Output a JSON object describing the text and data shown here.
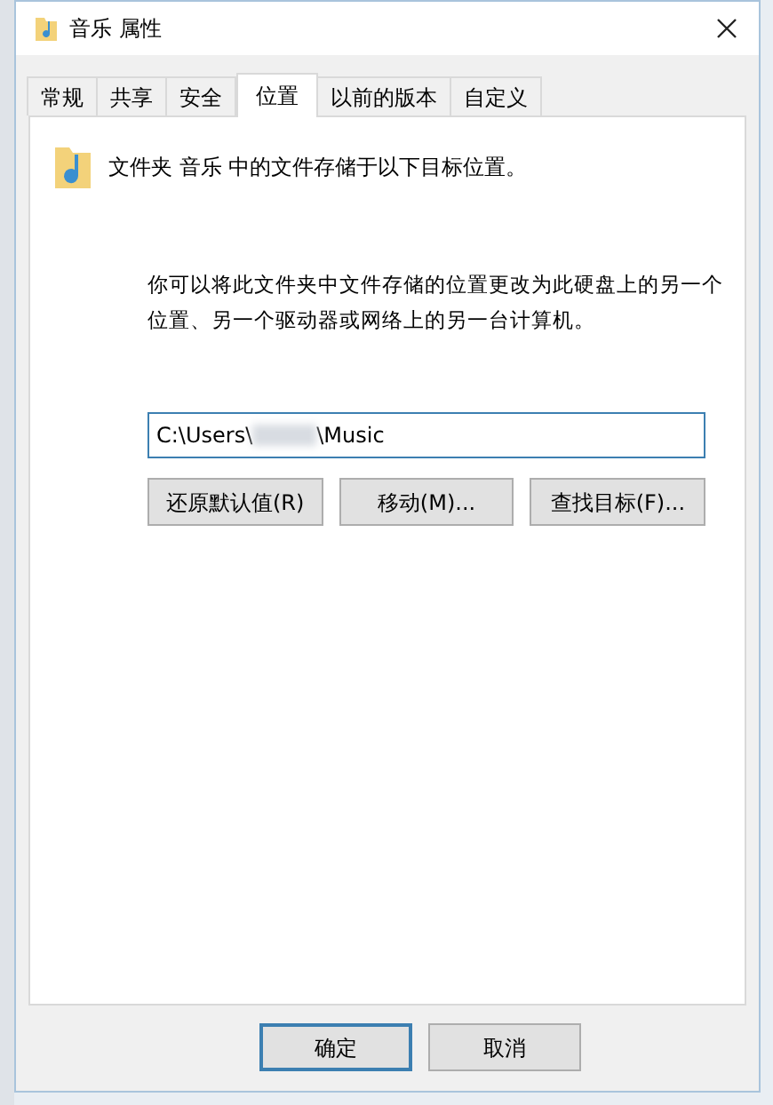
{
  "window": {
    "title": "音乐 属性"
  },
  "tabs": [
    {
      "label": "常规",
      "selected": false
    },
    {
      "label": "共享",
      "selected": false
    },
    {
      "label": "安全",
      "selected": false
    },
    {
      "label": "位置",
      "selected": true
    },
    {
      "label": "以前的版本",
      "selected": false
    },
    {
      "label": "自定义",
      "selected": false
    }
  ],
  "heading": "文件夹 音乐 中的文件存储于以下目标位置。",
  "description": "你可以将此文件夹中文件存储的位置更改为此硬盘上的另一个位置、另一个驱动器或网络上的另一台计算机。",
  "path": {
    "value_before_redaction": "C:\\Users\\",
    "value_after_redaction": "\\Music"
  },
  "actions": [
    "还原默认值(R)",
    "移动(M)...",
    "查找目标(F)..."
  ],
  "footer_buttons": [
    {
      "label": "确定",
      "default": true
    },
    {
      "label": "取消",
      "default": false
    }
  ]
}
